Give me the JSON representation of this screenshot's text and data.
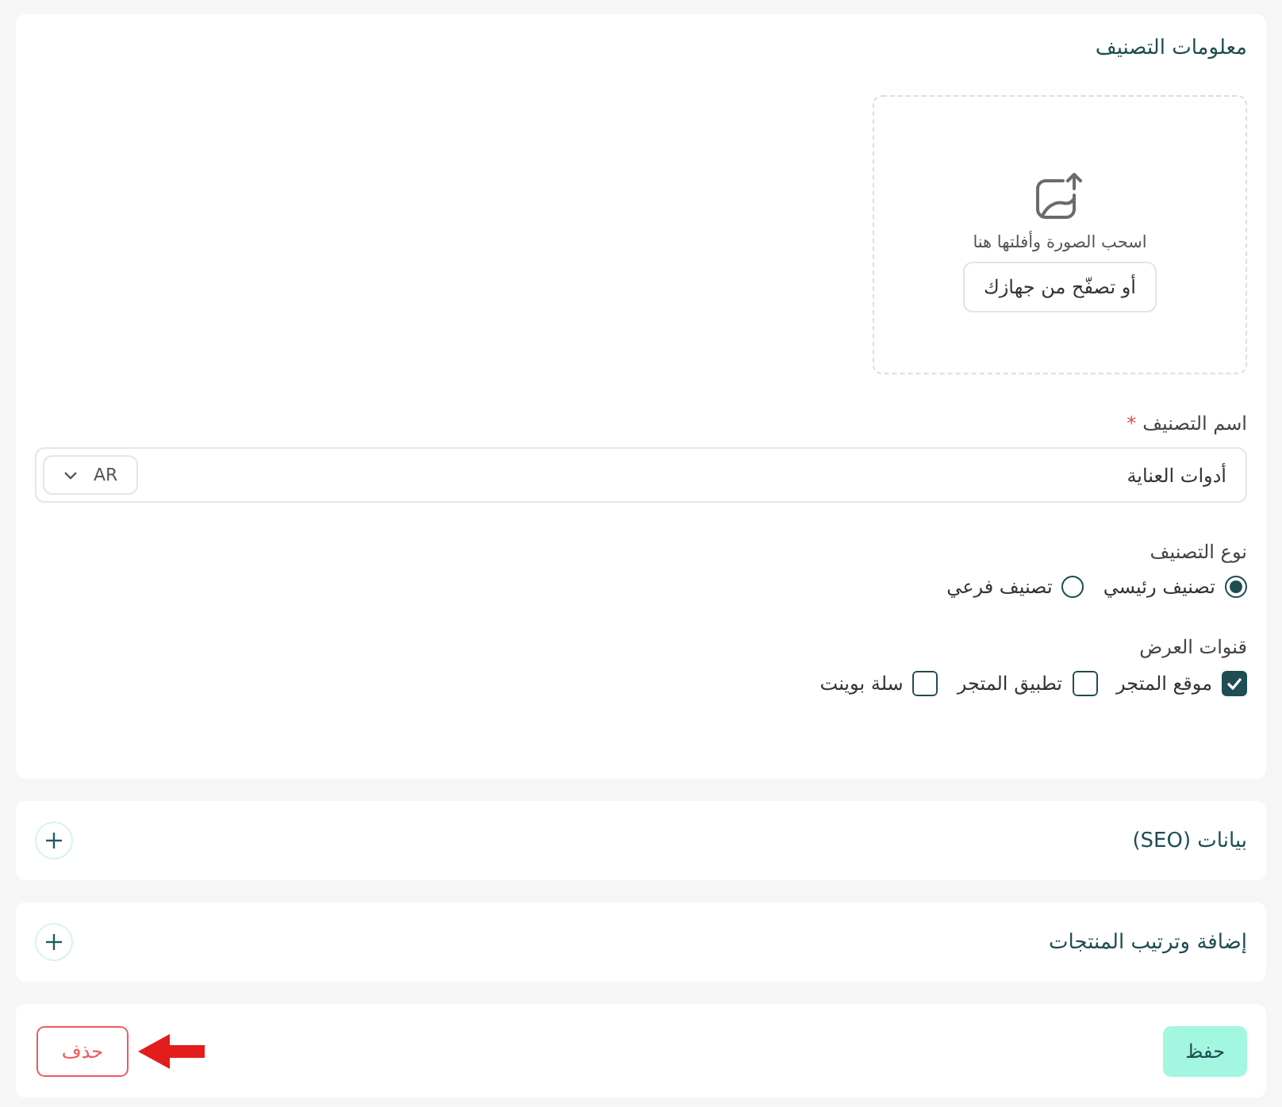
{
  "info_card": {
    "title": "معلومات التصنيف",
    "upload": {
      "hint": "اسحب الصورة وأفلتها هنا",
      "browse_button": "أو تصفّح من جهازك"
    },
    "name_field": {
      "label": "اسم التصنيف",
      "required_mark": "*",
      "value": "أدوات العناية",
      "language": "AR"
    },
    "type_group": {
      "label": "نوع التصنيف",
      "options": [
        {
          "label": "تصنيف رئيسي",
          "selected": true
        },
        {
          "label": "تصنيف فرعي",
          "selected": false
        }
      ]
    },
    "channels_group": {
      "label": "قنوات العرض",
      "options": [
        {
          "label": "موقع المتجر",
          "checked": true
        },
        {
          "label": "تطبيق المتجر",
          "checked": false
        },
        {
          "label": "سلة بوينت",
          "checked": false
        }
      ]
    }
  },
  "sections": [
    {
      "title": "بيانات (SEO)",
      "expanded": false
    },
    {
      "title": "إضافة وترتيب المنتجات",
      "expanded": false
    }
  ],
  "footer": {
    "save_button": "حفظ",
    "delete_button": "حذف"
  }
}
